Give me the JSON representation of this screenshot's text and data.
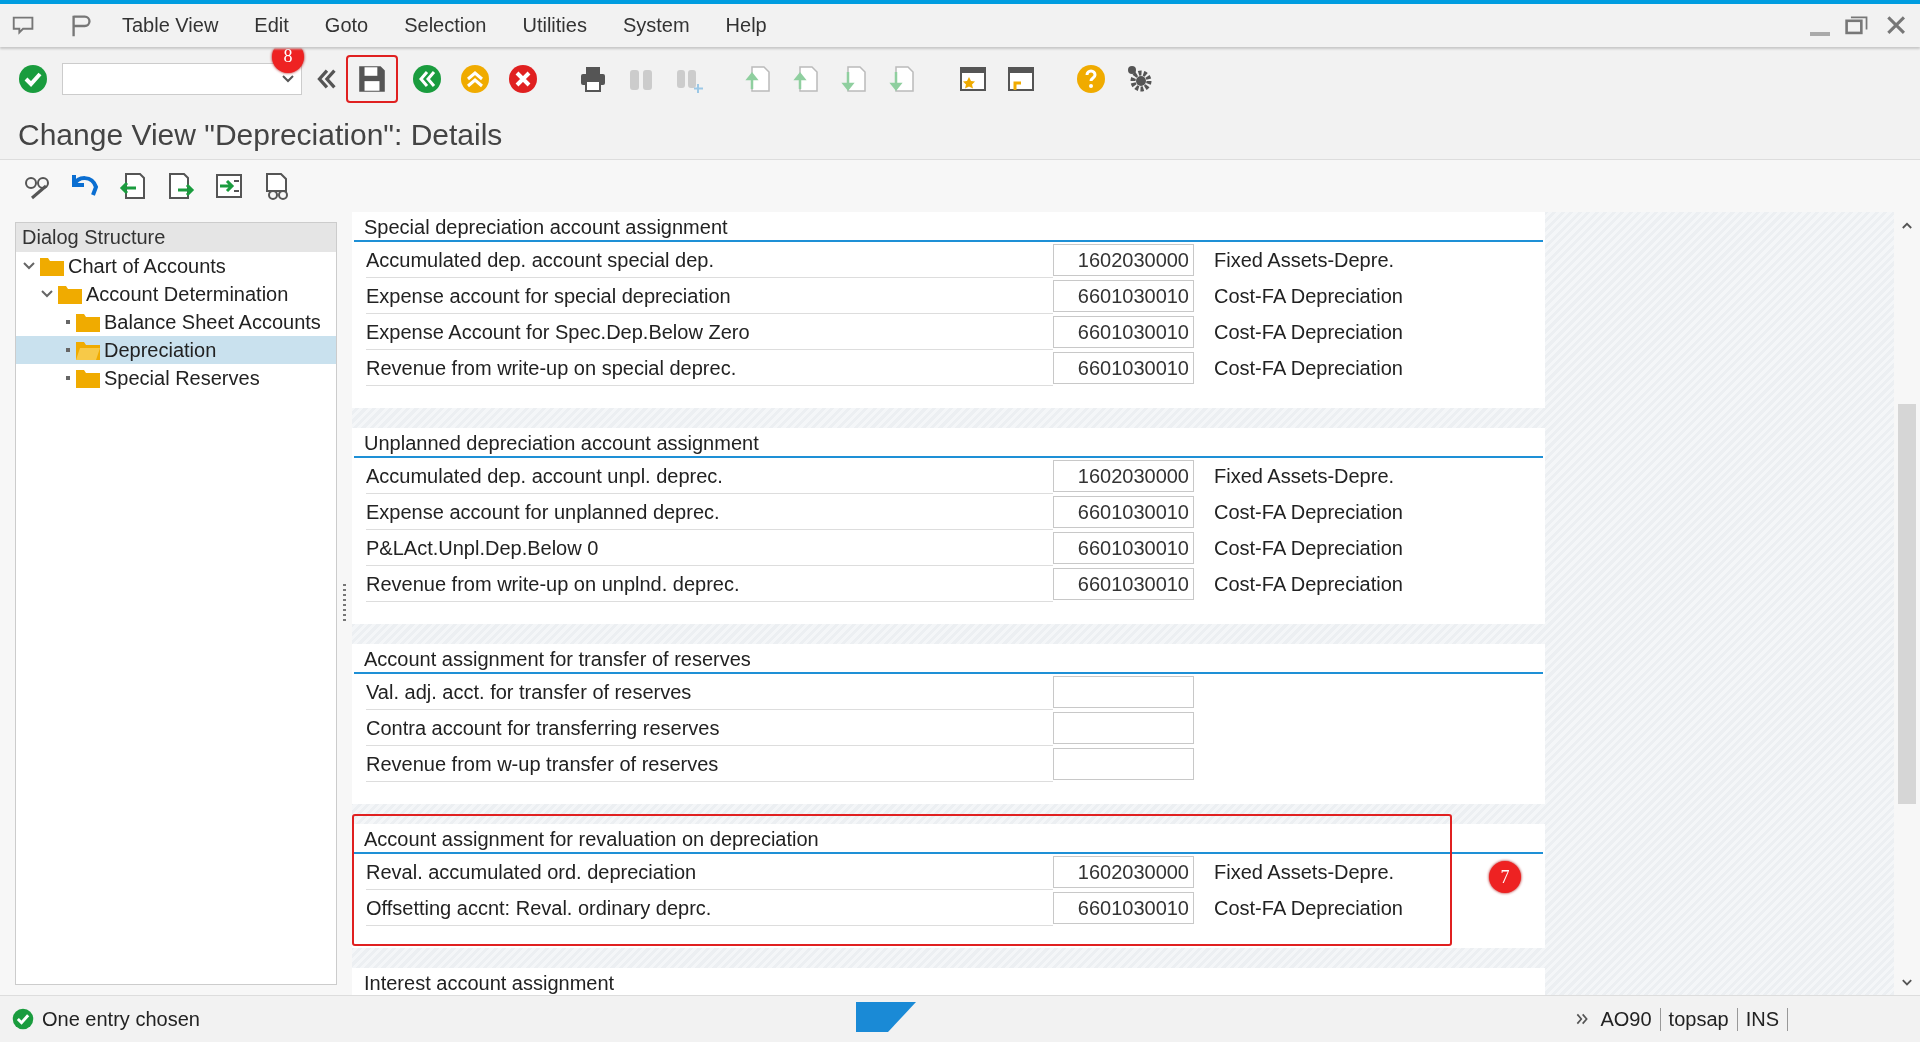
{
  "menu": [
    "Table View",
    "Edit",
    "Goto",
    "Selection",
    "Utilities",
    "System",
    "Help"
  ],
  "title": "Change View \"Depreciation\": Details",
  "annotations": {
    "save_badge": "8",
    "section_badge": "7"
  },
  "tree": {
    "header": "Dialog Structure",
    "items": [
      {
        "label": "Chart of Accounts",
        "expanded": true,
        "selected": false,
        "children": [
          {
            "label": "Account Determination",
            "expanded": true,
            "selected": false,
            "children": [
              {
                "label": "Balance Sheet Accounts",
                "selected": false
              },
              {
                "label": "Depreciation",
                "selected": true
              },
              {
                "label": "Special Reserves",
                "selected": false
              }
            ]
          }
        ]
      }
    ]
  },
  "sections": [
    {
      "title": "Special depreciation account assignment",
      "highlighted": false,
      "rows": [
        {
          "label": "Accumulated dep. account special dep.",
          "value": "1602030000",
          "description": "Fixed Assets-Depre."
        },
        {
          "label": "Expense account for special depreciation",
          "value": "6601030010",
          "description": "Cost-FA Depreciation"
        },
        {
          "label": "Expense Account for Spec.Dep.Below Zero",
          "value": "6601030010",
          "description": "Cost-FA Depreciation"
        },
        {
          "label": "Revenue from write-up on special deprec.",
          "value": "6601030010",
          "description": "Cost-FA Depreciation"
        }
      ]
    },
    {
      "title": "Unplanned depreciation account assignment",
      "highlighted": false,
      "rows": [
        {
          "label": "Accumulated dep. account unpl. deprec.",
          "value": "1602030000",
          "description": "Fixed Assets-Depre."
        },
        {
          "label": "Expense account for unplanned deprec.",
          "value": "6601030010",
          "description": "Cost-FA Depreciation"
        },
        {
          "label": "P&LAct.Unpl.Dep.Below 0",
          "value": "6601030010",
          "description": "Cost-FA Depreciation"
        },
        {
          "label": "Revenue from write-up on unplnd. deprec.",
          "value": "6601030010",
          "description": "Cost-FA Depreciation"
        }
      ]
    },
    {
      "title": "Account assignment for transfer of reserves",
      "highlighted": false,
      "rows": [
        {
          "label": "Val. adj. acct. for transfer of reserves"
        },
        {
          "label": "Contra account for transferring reserves"
        },
        {
          "label": "Revenue from w-up transfer of reserves"
        }
      ]
    },
    {
      "title": "Account assignment for revaluation on depreciation",
      "highlighted": true,
      "rows": [
        {
          "label": "Reval. accumulated ord. depreciation",
          "value": "1602030000",
          "description": "Fixed Assets-Depre."
        },
        {
          "label": "Offsetting accnt: Reval. ordinary deprc.",
          "value": "6601030010",
          "description": "Cost-FA Depreciation"
        }
      ]
    },
    {
      "title": "Interest account assignment",
      "highlighted": false
    }
  ],
  "status": {
    "message": "One entry chosen",
    "items": [
      "AO90",
      "topsap",
      "INS"
    ]
  }
}
